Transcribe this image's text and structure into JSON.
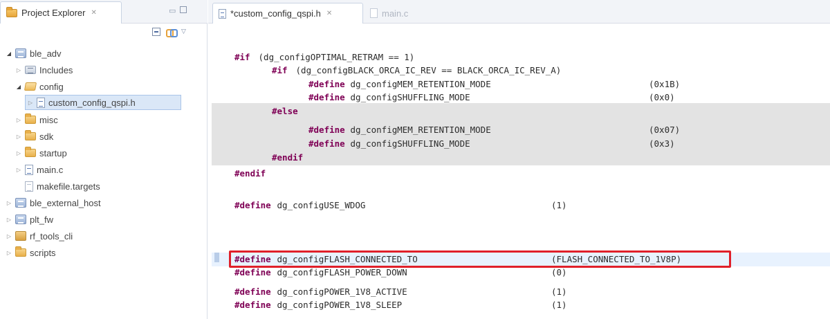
{
  "explorer": {
    "tab_label": "Project Explorer",
    "tab_close": "✕",
    "minimize": "▭",
    "toolbar_menu": "▽",
    "tree": [
      {
        "label": "ble_adv",
        "twisty": "◢",
        "icon": "project-icon"
      },
      {
        "label": "Includes",
        "twisty": "▷",
        "icon": "includes-icon"
      },
      {
        "label": "config",
        "twisty": "◢",
        "icon": "folder-open-icon"
      },
      {
        "label": "custom_config_qspi.h",
        "twisty": "▷",
        "icon": "header-file-icon",
        "selected": true
      },
      {
        "label": "misc",
        "twisty": "▷",
        "icon": "folder-icon"
      },
      {
        "label": "sdk",
        "twisty": "▷",
        "icon": "folder-icon"
      },
      {
        "label": "startup",
        "twisty": "▷",
        "icon": "folder-icon"
      },
      {
        "label": "main.c",
        "twisty": "▷",
        "icon": "c-file-icon"
      },
      {
        "label": "makefile.targets",
        "twisty": "",
        "icon": "text-file-icon"
      },
      {
        "label": "ble_external_host",
        "twisty": "▷",
        "icon": "project-icon"
      },
      {
        "label": "plt_fw",
        "twisty": "▷",
        "icon": "project-icon"
      },
      {
        "label": "rf_tools_cli",
        "twisty": "▷",
        "icon": "tools-project-icon"
      },
      {
        "label": "scripts",
        "twisty": "▷",
        "icon": "folder-icon"
      }
    ]
  },
  "editor": {
    "tabs": [
      {
        "label": "*custom_config_qspi.h",
        "close": "✕",
        "active": true
      },
      {
        "label": "main.c",
        "active": false
      }
    ],
    "lines": [
      {
        "kw": "#if",
        "text": " (dg_configOPTIMAL_RETRAM == 1)",
        "value": ""
      },
      {
        "kw": "#if",
        "text": " (dg_configBLACK_ORCA_IC_REV == BLACK_ORCA_IC_REV_A)",
        "value": ""
      },
      {
        "kw": "#define",
        "text": " dg_configMEM_RETENTION_MODE",
        "value": "(0x1B)"
      },
      {
        "kw": "#define",
        "text": " dg_configSHUFFLING_MODE",
        "value": "(0x0)"
      },
      {
        "kw": "#else",
        "text": "",
        "value": ""
      },
      {
        "kw": "#define",
        "text": " dg_configMEM_RETENTION_MODE",
        "value": "(0x07)"
      },
      {
        "kw": "#define",
        "text": " dg_configSHUFFLING_MODE",
        "value": "(0x3)"
      },
      {
        "kw": "#endif",
        "text": "",
        "value": ""
      },
      {
        "kw": "#endif",
        "text": "",
        "value": ""
      },
      {
        "kw": "#define",
        "text": " dg_configUSE_WDOG",
        "value": "(1)"
      },
      {
        "kw": "#define",
        "text": " dg_configFLASH_CONNECTED_TO",
        "value": "(FLASH_CONNECTED_TO_1V8P)"
      },
      {
        "kw": "#define",
        "text": " dg_configFLASH_POWER_DOWN",
        "value": "(0)"
      },
      {
        "kw": "#define",
        "text": " dg_configPOWER_1V8_ACTIVE",
        "value": "(1)"
      },
      {
        "kw": "#define",
        "text": " dg_configPOWER_1V8_SLEEP",
        "value": "(1)"
      }
    ]
  },
  "colors": {
    "keyword": "#7f0055",
    "highlight_box": "#e0202a",
    "inactive_block": "#e3e3e3",
    "selection": "#dae7f7"
  }
}
